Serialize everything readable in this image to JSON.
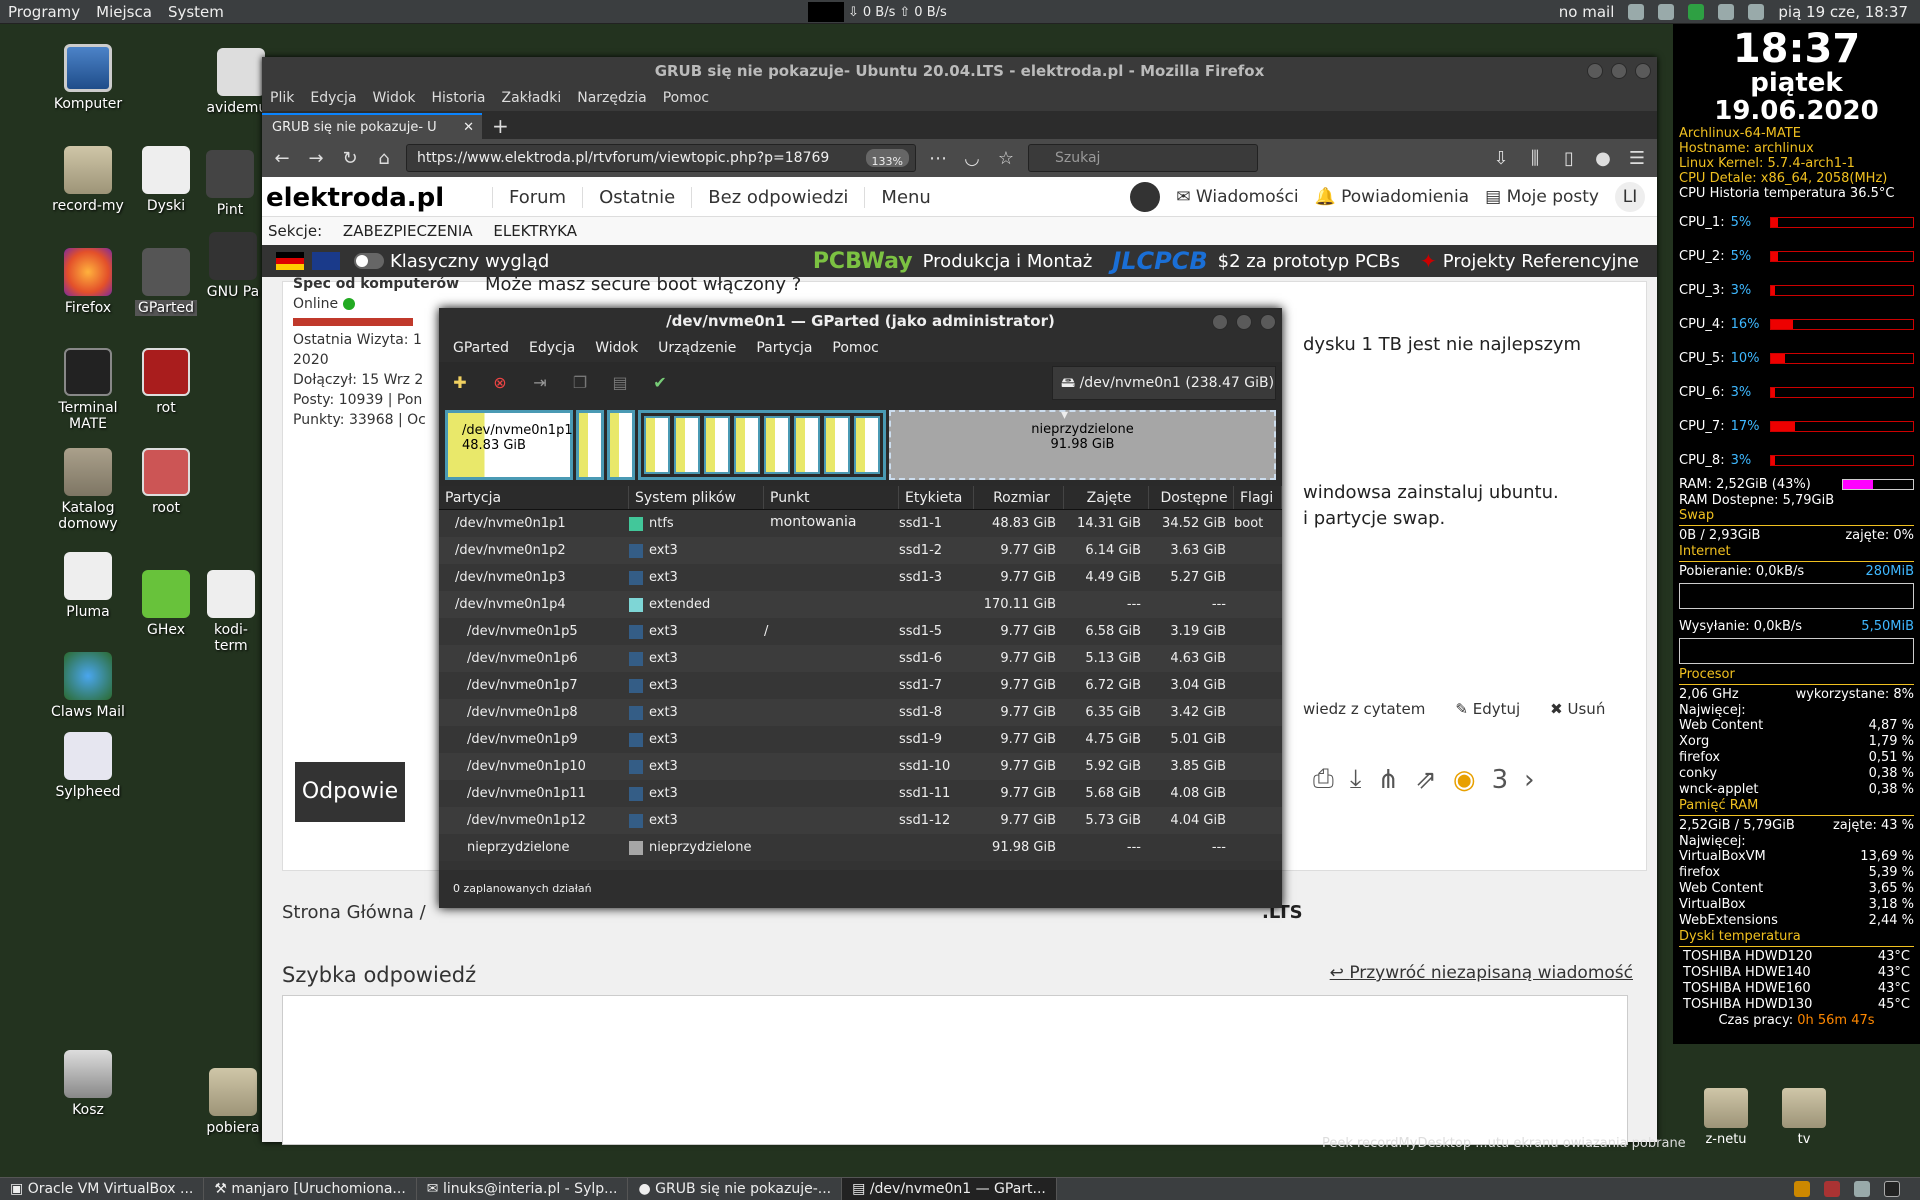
{
  "top_panel": {
    "menus": [
      "Programy",
      "Miejsca",
      "System"
    ],
    "net_down": "0 B/s",
    "net_up": "0 B/s",
    "mail_status": "no mail",
    "datetime": "pią 19 cze, 18:37"
  },
  "desktop_icons": [
    {
      "label": "Komputer",
      "icon": "computer-icon"
    },
    {
      "label": "record-my",
      "icon": "folder-icon"
    },
    {
      "label": "Dyski",
      "icon": "disks-icon"
    },
    {
      "label": "Firefox",
      "icon": "firefox-icon"
    },
    {
      "label": "GParted",
      "icon": "gparted-icon"
    },
    {
      "label": "Terminal MATE",
      "icon": "terminal-icon"
    },
    {
      "label": "rot",
      "icon": "root-terminal-icon"
    },
    {
      "label": "Katalog domowy",
      "icon": "home-folder-icon"
    },
    {
      "label": "root",
      "icon": "root-cabinet-icon"
    },
    {
      "label": "Pluma",
      "icon": "text-editor-icon"
    },
    {
      "label": "GHex",
      "icon": "ghex-icon"
    },
    {
      "label": "Claws Mail",
      "icon": "claws-mail-icon"
    },
    {
      "label": "Sylpheed",
      "icon": "sylpheed-icon"
    },
    {
      "label": "Kosz",
      "icon": "trash-icon"
    },
    {
      "label": "avidemux",
      "icon": "avidemux-icon"
    },
    {
      "label": "Pint",
      "icon": "pinta-icon"
    },
    {
      "label": "GNU Pa",
      "icon": "gnu-paint-icon"
    },
    {
      "label": "kodi-term",
      "icon": "file-icon"
    },
    {
      "label": "pobiera",
      "icon": "folder-icon"
    }
  ],
  "firefox": {
    "title": "GRUB się nie pokazuje- Ubuntu 20.04.LTS - elektroda.pl - Mozilla Firefox",
    "menu": [
      "Plik",
      "Edycja",
      "Widok",
      "Historia",
      "Zakładki",
      "Narzędzia",
      "Pomoc"
    ],
    "tab_title": "GRUB się nie pokazuje- U",
    "url": "https://www.elektroda.pl/rtvforum/viewtopic.php?p=18769",
    "zoom": "133%",
    "search_placeholder": "Szukaj"
  },
  "site": {
    "logo": "elektroda.pl",
    "nav": [
      "Forum",
      "Ostatnie",
      "Bez odpowiedzi",
      "Menu"
    ],
    "nav_right": [
      "Wiadomości",
      "Powiadomienia",
      "Moje posty",
      "LI"
    ],
    "sections_label": "Sekcje:",
    "sections": [
      "ZABEZPIECZENIA",
      "ELEKTRYKA"
    ],
    "classic_view": "Klasyczny wygląd",
    "promo": [
      "Produkcja i Montaż",
      "$2 za prototyp PCBs",
      "Projekty Referencyjne"
    ],
    "promo_brands": [
      "PCBWay",
      "JLCPCB"
    ],
    "user": {
      "rank": "Spec od komputerów",
      "status": "Online",
      "last_visit": "Ostatnia Wizyta: 1",
      "year": "2020",
      "joined": "Dołączył: 15 Wrz 2",
      "posts": "Posty: 10939 | Pon",
      "points": "Punkty: 33968 | Oc"
    },
    "post_lines": [
      "Może masz secure boot włączony ?",
      "dysku 1 TB jest nie najlepszym",
      "windowsa zainstaluj ubuntu.",
      "i partycje swap."
    ],
    "post_actions": [
      "wiedz z cytatem",
      "Edytuj",
      "Usuń"
    ],
    "reply_button": "Odpowie",
    "views": "3",
    "breadcrumb_home": "Strona Główna",
    "breadcrumb_sep": "/",
    "breadcrumb_tail": ".LTS",
    "quick_reply": "Szybka odpowiedź",
    "restore_draft": "Przywróć niezapisaną wiadomość"
  },
  "gparted": {
    "title": "/dev/nvme0n1 — GParted (jako administrator)",
    "menu": [
      "GParted",
      "Edycja",
      "Widok",
      "Urządzenie",
      "Partycja",
      "Pomoc"
    ],
    "device": "/dev/nvme0n1 (238.47 GiB)",
    "graph": {
      "first_name": "/dev/nvme0n1p1",
      "first_size": "48.83 GiB",
      "unalloc_name": "nieprzydzielone",
      "unalloc_size": "91.98 GiB"
    },
    "columns": [
      "Partycja",
      "System plików",
      "Punkt montowania",
      "Etykieta",
      "Rozmiar",
      "Zajęte",
      "Dostępne",
      "Flagi"
    ],
    "rows": [
      {
        "name": "/dev/nvme0n1p1",
        "fs": "ntfs",
        "color": "#42c79a",
        "mount": "",
        "label": "ssd1-1",
        "size": "48.83 GiB",
        "used": "14.31 GiB",
        "free": "34.52 GiB",
        "flags": "boot"
      },
      {
        "name": "/dev/nvme0n1p2",
        "fs": "ext3",
        "color": "#345d86",
        "mount": "",
        "label": "ssd1-2",
        "size": "9.77 GiB",
        "used": "6.14 GiB",
        "free": "3.63 GiB",
        "flags": ""
      },
      {
        "name": "/dev/nvme0n1p3",
        "fs": "ext3",
        "color": "#345d86",
        "mount": "",
        "label": "ssd1-3",
        "size": "9.77 GiB",
        "used": "4.49 GiB",
        "free": "5.27 GiB",
        "flags": ""
      },
      {
        "name": "/dev/nvme0n1p4",
        "fs": "extended",
        "color": "#7ed6d6",
        "mount": "",
        "label": "",
        "size": "170.11 GiB",
        "used": "---",
        "free": "---",
        "flags": ""
      },
      {
        "name": "/dev/nvme0n1p5",
        "fs": "ext3",
        "color": "#345d86",
        "mount": "/",
        "label": "ssd1-5",
        "size": "9.77 GiB",
        "used": "6.58 GiB",
        "free": "3.19 GiB",
        "flags": ""
      },
      {
        "name": "/dev/nvme0n1p6",
        "fs": "ext3",
        "color": "#345d86",
        "mount": "",
        "label": "ssd1-6",
        "size": "9.77 GiB",
        "used": "5.13 GiB",
        "free": "4.63 GiB",
        "flags": ""
      },
      {
        "name": "/dev/nvme0n1p7",
        "fs": "ext3",
        "color": "#345d86",
        "mount": "",
        "label": "ssd1-7",
        "size": "9.77 GiB",
        "used": "6.72 GiB",
        "free": "3.04 GiB",
        "flags": ""
      },
      {
        "name": "/dev/nvme0n1p8",
        "fs": "ext3",
        "color": "#345d86",
        "mount": "",
        "label": "ssd1-8",
        "size": "9.77 GiB",
        "used": "6.35 GiB",
        "free": "3.42 GiB",
        "flags": ""
      },
      {
        "name": "/dev/nvme0n1p9",
        "fs": "ext3",
        "color": "#345d86",
        "mount": "",
        "label": "ssd1-9",
        "size": "9.77 GiB",
        "used": "4.75 GiB",
        "free": "5.01 GiB",
        "flags": ""
      },
      {
        "name": "/dev/nvme0n1p10",
        "fs": "ext3",
        "color": "#345d86",
        "mount": "",
        "label": "ssd1-10",
        "size": "9.77 GiB",
        "used": "5.92 GiB",
        "free": "3.85 GiB",
        "flags": ""
      },
      {
        "name": "/dev/nvme0n1p11",
        "fs": "ext3",
        "color": "#345d86",
        "mount": "",
        "label": "ssd1-11",
        "size": "9.77 GiB",
        "used": "5.68 GiB",
        "free": "4.08 GiB",
        "flags": ""
      },
      {
        "name": "/dev/nvme0n1p12",
        "fs": "ext3",
        "color": "#345d86",
        "mount": "",
        "label": "ssd1-12",
        "size": "9.77 GiB",
        "used": "5.73 GiB",
        "free": "4.04 GiB",
        "flags": ""
      },
      {
        "name": "nieprzydzielone",
        "fs": "nieprzydzielone",
        "color": "#a6a6a6",
        "mount": "",
        "label": "",
        "size": "91.98 GiB",
        "used": "---",
        "free": "---",
        "flags": ""
      }
    ],
    "status": "0 zaplanowanych działań"
  },
  "conky": {
    "time": "18:37",
    "day": "piątek",
    "date": "19.06.2020",
    "os": "Archlinux-64-MATE",
    "hostname": "Hostname: archlinux",
    "kernel": "Linux Kernel: 5.7.4-arch1-1",
    "cpu_detail": "CPU Detale:  x86_64, 2058(MHz)",
    "cpu_temp": "CPU Historia temperatura 36.5°C",
    "cpus": [
      {
        "label": "CPU_1:",
        "pct": "5%",
        "value": 5
      },
      {
        "label": "CPU_2:",
        "pct": "5%",
        "value": 5
      },
      {
        "label": "CPU_3:",
        "pct": "3%",
        "value": 3
      },
      {
        "label": "CPU_4:",
        "pct": "16%",
        "value": 16
      },
      {
        "label": "CPU_5:",
        "pct": "10%",
        "value": 10
      },
      {
        "label": "CPU_6:",
        "pct": "3%",
        "value": 3
      },
      {
        "label": "CPU_7:",
        "pct": "17%",
        "value": 17
      },
      {
        "label": "CPU_8:",
        "pct": "3%",
        "value": 3
      }
    ],
    "ram": "RAM: 2,52GiB (43%)",
    "ram_pct": 43,
    "ram_available": "RAM Dostepne: 5,79GiB",
    "swap_title": "Swap",
    "swap": "0B   / 2,93GiB",
    "swap_used": "zajęte: 0%",
    "internet_title": "Internet",
    "download": "Pobieranie: 0,0kB/s",
    "download_max": "280MiB",
    "upload": "Wysyłanie: 0,0kB/s",
    "upload_max": "5,50MiB",
    "proc_title": "Procesor",
    "freq": "2,06 GHz",
    "cpu_used": "wykorzystane: 8%",
    "top_title": "Najwięcej:",
    "top_cpu": [
      {
        "name": "Web Content",
        "val": "4,87 %"
      },
      {
        "name": "Xorg",
        "val": "1,79 %"
      },
      {
        "name": "firefox",
        "val": "0,51 %"
      },
      {
        "name": "conky",
        "val": "0,38 %"
      },
      {
        "name": "wnck-applet",
        "val": "0,38 %"
      }
    ],
    "mem_title": "Pamięć RAM",
    "mem": "2,52GiB / 5,79GiB",
    "mem_used": "zajęte: 43 %",
    "top_mem": [
      {
        "name": "VirtualBoxVM",
        "val": "13,69 %"
      },
      {
        "name": "firefox",
        "val": "5,39 %"
      },
      {
        "name": "Web Content",
        "val": "3,65 %"
      },
      {
        "name": "VirtualBox",
        "val": "3,18 %"
      },
      {
        "name": "WebExtensions",
        "val": "2,44 %"
      }
    ],
    "disk_title": "Dyski temperatura",
    "disks": [
      {
        "name": "TOSHIBA HDWD120",
        "val": "43°C"
      },
      {
        "name": "TOSHIBA HDWE140",
        "val": "43°C"
      },
      {
        "name": "TOSHIBA HDWE160",
        "val": "43°C"
      },
      {
        "name": "TOSHIBA HDWD130",
        "val": "45°C"
      }
    ],
    "uptime_label": "Czas pracy:",
    "uptime": "0h 56m 47s"
  },
  "right_icons": [
    "z-netu",
    "tv"
  ],
  "right_labels_behind": "Peek recordMyDesktop  ...utu ekranu owiazania   pobrane",
  "taskbar": [
    {
      "label": "Oracle VM VirtualBox ...",
      "active": false
    },
    {
      "label": "manjaro [Uruchomiona...",
      "active": false
    },
    {
      "label": "linuks@interia.pl - Sylp...",
      "active": false
    },
    {
      "label": "GRUB się nie pokazuje-...",
      "active": false
    },
    {
      "label": "/dev/nvme0n1 — GPart...",
      "active": true
    }
  ]
}
